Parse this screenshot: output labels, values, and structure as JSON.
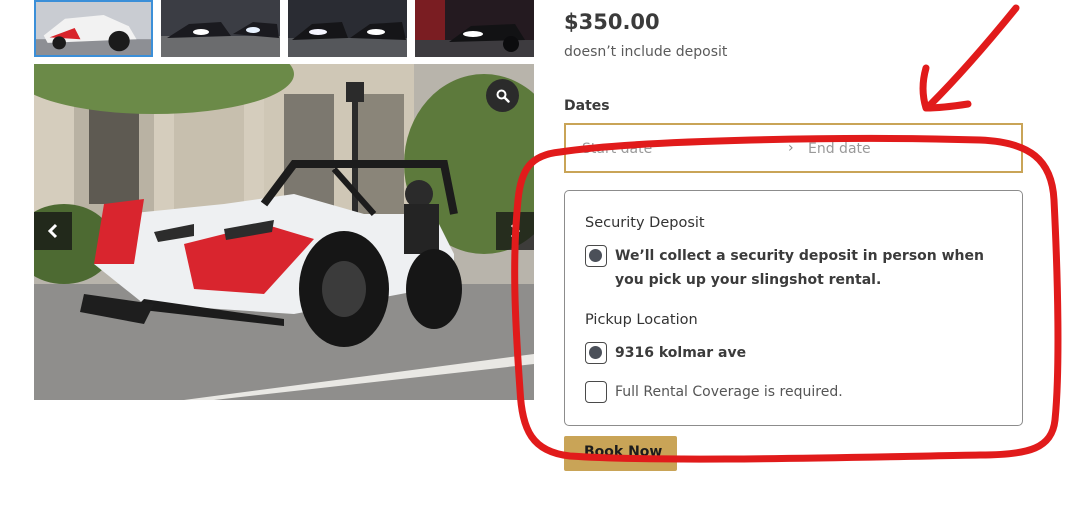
{
  "product": {
    "price": "$350.00",
    "price_note": "doesn’t include deposit"
  },
  "gallery": {
    "thumbnail_count": 4,
    "active_thumbnail": 1,
    "zoom_icon": "magnifier-icon",
    "prev_icon": "chevron-left-icon",
    "next_icon": "chevron-right-icon"
  },
  "booking": {
    "dates_label": "Dates",
    "start_placeholder": "Start date",
    "end_placeholder": "End date",
    "separator_icon": "chevron-right-icon"
  },
  "options": {
    "security_heading": "Security Deposit",
    "security_option": "We’ll collect a security deposit in person when you pick up your slingshot rental.",
    "security_selected": true,
    "pickup_heading": "Pickup Location",
    "pickup_option": "9316 kolmar ave",
    "pickup_selected": true,
    "coverage_label": "Full Rental Coverage is required.",
    "coverage_checked": false
  },
  "actions": {
    "book_label": "Book Now"
  },
  "colors": {
    "accent_gold": "#c9a457",
    "thumbnail_active_border": "#3b8fd8",
    "annotation_red": "#e11b1b"
  }
}
